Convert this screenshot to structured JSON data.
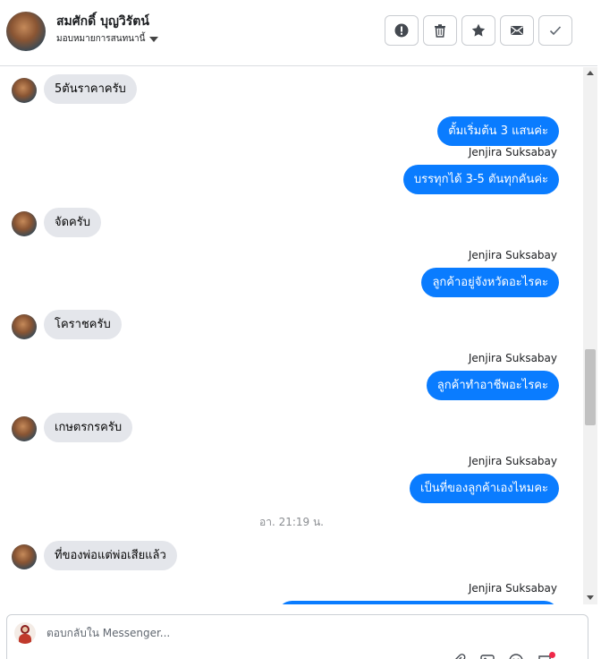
{
  "header": {
    "contact_name": "สมศักดิ์ บุญวิรัตน์",
    "assign_label": "มอบหมายการสนทนานี้",
    "actions": [
      {
        "icon": "alert-icon",
        "label": "Mark as spam"
      },
      {
        "icon": "trash-icon",
        "label": "Delete"
      },
      {
        "icon": "star-icon",
        "label": "Follow up"
      },
      {
        "icon": "envelope-icon",
        "label": "Mark as unread"
      },
      {
        "icon": "check-icon",
        "label": "Mark as done"
      }
    ]
  },
  "messages": [
    {
      "direction": "in",
      "text": "5ตันราคาครับ"
    },
    {
      "direction": "out",
      "text": "ตั้มเริ่มต้น 3 แสนค่ะ"
    },
    {
      "direction": "out",
      "sender": "Jenjira Suksabay",
      "text": "บรรทุกได้ 3-5 ตันทุกคันค่ะ"
    },
    {
      "direction": "in",
      "text": "จัดครับ"
    },
    {
      "direction": "out",
      "sender": "Jenjira Suksabay",
      "text": "ลูกค้าอยู่จังหวัดอะไรคะ"
    },
    {
      "direction": "in",
      "text": "โคราชครับ"
    },
    {
      "direction": "out",
      "sender": "Jenjira Suksabay",
      "text": "ลูกค้าทำอาชีพอะไรคะ"
    },
    {
      "direction": "in",
      "text": "เกษตรกรครับ"
    },
    {
      "direction": "out",
      "sender": "Jenjira Suksabay",
      "text": "เป็นที่ของลูกค้าเองไหมคะ"
    },
    {
      "timestamp": "อา. 21:19 น."
    },
    {
      "direction": "in",
      "text": "ที่ของพ่อแต่พ่อเสียแล้ว"
    },
    {
      "direction": "out",
      "sender": "Jenjira Suksabay",
      "text": ""
    }
  ],
  "composer": {
    "placeholder": "ตอบกลับใน Messenger...",
    "value": "",
    "tools": [
      "attachment-icon",
      "image-icon",
      "emoji-icon",
      "saved-reply-icon"
    ]
  }
}
